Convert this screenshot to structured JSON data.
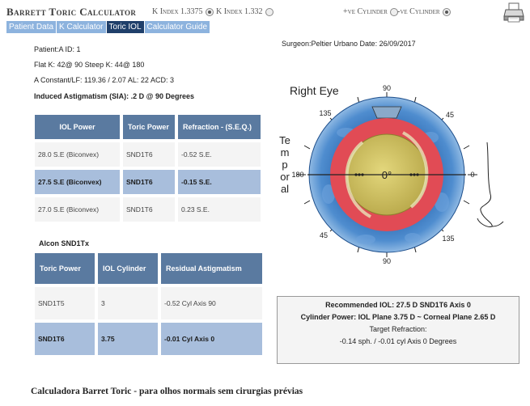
{
  "header": {
    "title": "Barrett Toric Calculator",
    "k_index_options": [
      {
        "label": "K Index 1.3375",
        "selected": true
      },
      {
        "label": "K Index 1.332",
        "selected": false
      }
    ],
    "cylinder_options": [
      {
        "label": "+ve Cylinder",
        "selected": false
      },
      {
        "label": "-ve Cylinder",
        "selected": true
      }
    ]
  },
  "tabs": [
    {
      "label": "Patient Data",
      "active": false
    },
    {
      "label": "K Calculator",
      "active": false
    },
    {
      "label": "Toric IOL",
      "active": true
    },
    {
      "label": "Calculator Guide",
      "active": false
    }
  ],
  "patient": {
    "patient_line": "Patient:A     ID: 1",
    "flat_steep": "Flat K: 42@ 90 Steep K: 44@ 180",
    "constants": "A Constant/LF: 119.36 / 2.07  AL: 22 ACD: 3",
    "sia": "Induced Astigmatism (SIA): .2 D @  90 Degrees",
    "surgeon": "Surgeon:Peltier Urbano    Date: 26/09/2017"
  },
  "iol_table": {
    "headers": [
      "IOL Power",
      "Toric Power",
      "Refraction - (S.E.Q.)"
    ],
    "rows": [
      [
        "28.0 S.E (Biconvex)",
        "SND1T6",
        "-0.52 S.E."
      ],
      [
        "27.5 S.E (Biconvex)",
        "SND1T6",
        "-0.15 S.E."
      ],
      [
        "27.0 S.E (Biconvex)",
        "SND1T6",
        "0.23 S.E."
      ]
    ],
    "selected_row": 1
  },
  "lens_model": "Alcon SND1Tx",
  "cyl_table": {
    "headers": [
      "Toric Power",
      "IOL Cylinder",
      "Residual Astigmatism"
    ],
    "rows": [
      [
        "SND1T5",
        "3",
        "-0.52 Cyl Axis 90"
      ],
      [
        "SND1T6",
        "3.75",
        "-0.01 Cyl Axis 0"
      ]
    ],
    "selected_row": 1
  },
  "diagram": {
    "eye": "Right Eye",
    "center_label": "0°",
    "side_label": "Temporal",
    "tick_labels": [
      "90",
      "45",
      "0",
      "135",
      "180",
      "45",
      "90",
      "135"
    ]
  },
  "result": {
    "recommended": "Recommended IOL: 27.5 D   SND1T6   Axis 0",
    "cylinder_power": "Cylinder Power: IOL Plane 3.75 D ~ Corneal Plane 2.65 D",
    "target_label": "Target Refraction:",
    "target_value": "-0.14 sph. / -0.01 cyl Axis 0 Degrees"
  },
  "caption": "Calculadora Barret Toric - para olhos normais sem cirurgias prévias",
  "colors": {
    "tab_bg": "#8db3de",
    "tab_active": "#1f3f6a",
    "table_header": "#5a7aa0",
    "selected_row": "#a8bedc",
    "ring_red": "#e14b55",
    "ring_blue": "#3a74b8",
    "lens_yellow": "#cbbd58"
  }
}
